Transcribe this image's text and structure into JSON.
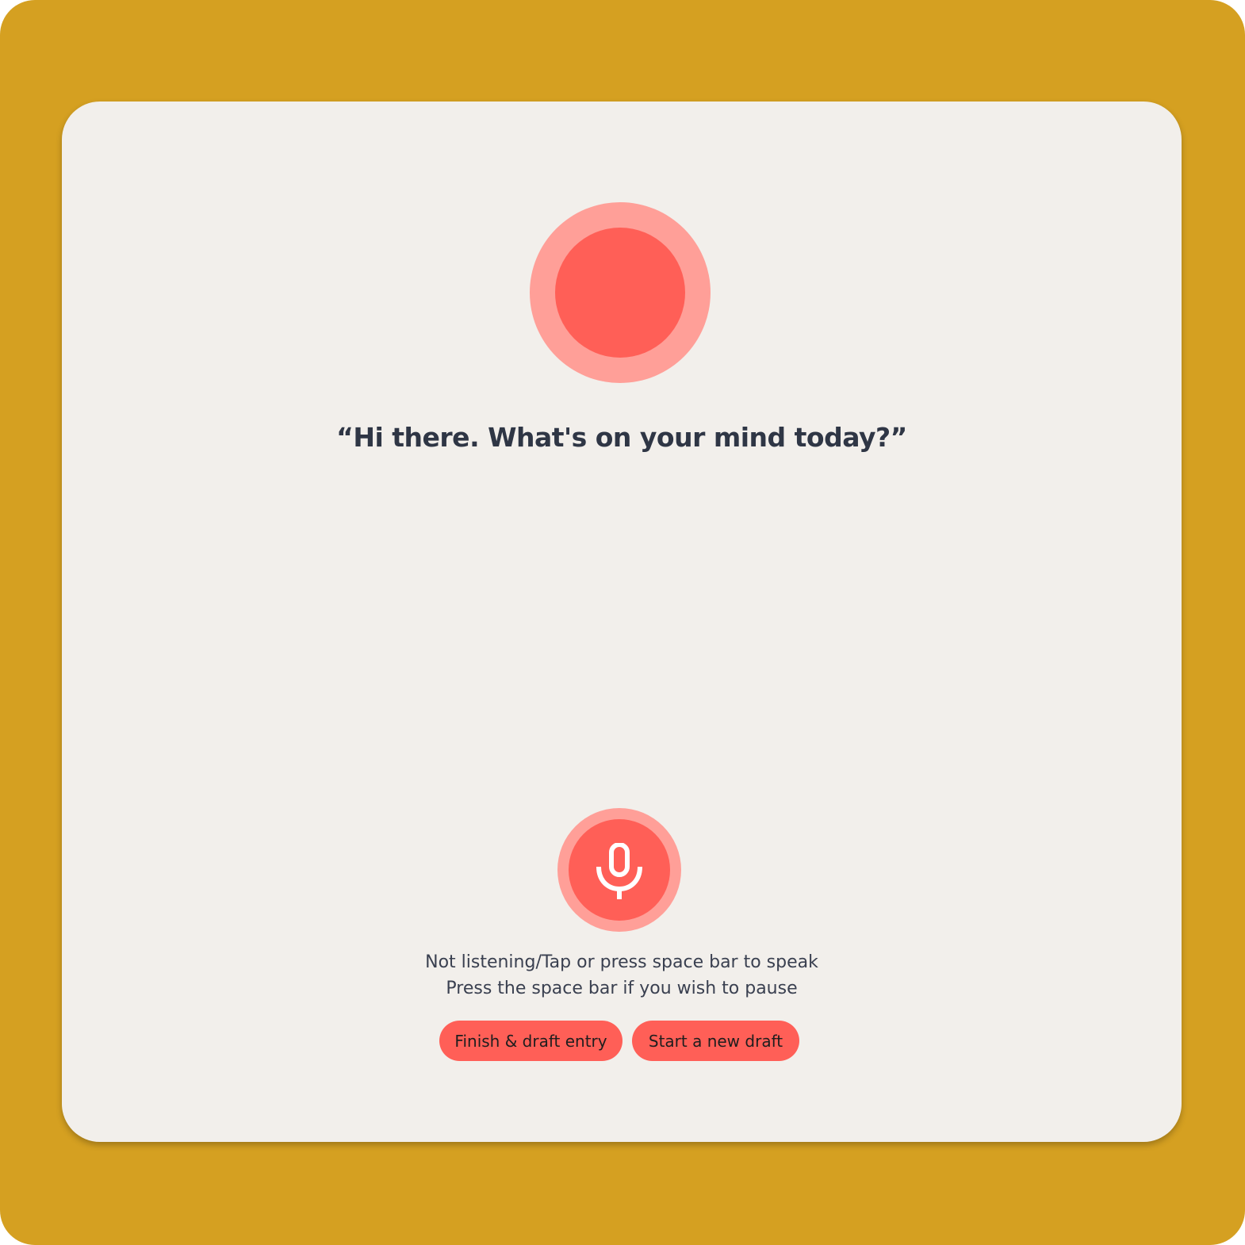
{
  "colors": {
    "frame_background": "#D5A021",
    "card_background": "#F2EFEB",
    "accent": "#FF5F57",
    "accent_light": "#FF9F98",
    "text_dark": "#2F3645"
  },
  "assistant": {
    "prompt": "“Hi there. What's on your mind today?”"
  },
  "mic": {
    "icon": "microphone-icon"
  },
  "status": {
    "line1": "Not listening/Tap or press space bar to speak",
    "line2": "Press the space bar if you wish to pause"
  },
  "actions": {
    "finish_label": "Finish & draft entry",
    "new_draft_label": "Start a new draft"
  }
}
